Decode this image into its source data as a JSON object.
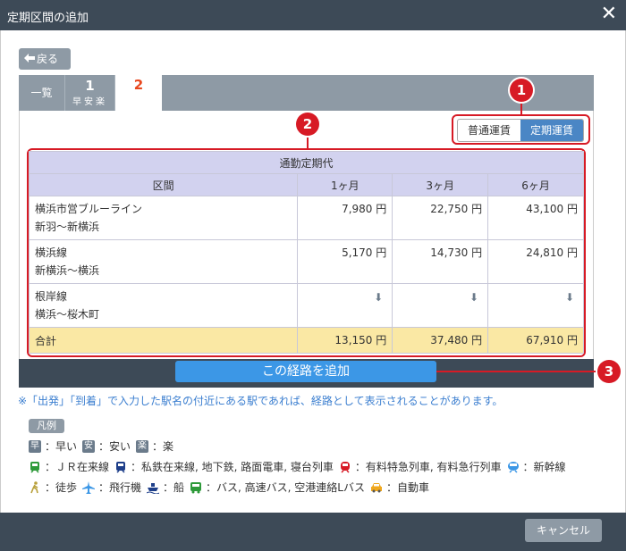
{
  "window": {
    "title": "定期区間の追加",
    "close_glyph": "✕"
  },
  "back_button": {
    "label": "戻る",
    "icon": "back-arrow-icon"
  },
  "tabs": [
    {
      "label": "一覧"
    },
    {
      "number": "1",
      "sub": "早安楽"
    },
    {
      "number": "2"
    }
  ],
  "fare_toggle": {
    "options": [
      "普通運賃",
      "定期運賃"
    ],
    "selected": "定期運賃"
  },
  "callouts": [
    "1",
    "2",
    "3"
  ],
  "fare_table": {
    "caption": "通勤定期代",
    "headers": [
      "区間",
      "1ヶ月",
      "3ヶ月",
      "6ヶ月"
    ],
    "rows": [
      {
        "line": "横浜市営ブルーライン",
        "section": "新羽〜新横浜",
        "m1": "7,980 円",
        "m3": "22,750 円",
        "m6": "43,100 円"
      },
      {
        "line": "横浜線",
        "section": "新横浜〜横浜",
        "m1": "5,170 円",
        "m3": "14,730 円",
        "m6": "24,810 円"
      },
      {
        "line": "根岸線",
        "section": "横浜〜桜木町",
        "arrow": "⬇"
      }
    ],
    "total": {
      "label": "合計",
      "m1": "13,150 円",
      "m3": "37,480 円",
      "m6": "67,910 円"
    }
  },
  "add_button": {
    "label": "この経路を追加"
  },
  "note": "※「出発」「到着」で入力した駅名の付近にある駅であれば、経路として表示されることがあります。",
  "legend": {
    "title": "凡例",
    "row1": [
      {
        "icon": "早",
        "text": "：早い"
      },
      {
        "icon": "安",
        "text": "：安い"
      },
      {
        "icon": "楽",
        "text": "：楽"
      }
    ],
    "row2": [
      {
        "text": "：ＪＲ在来線"
      },
      {
        "text": "：私鉄在来線, 地下鉄, 路面電車, 寝台列車"
      },
      {
        "text": "：有料特急列車, 有料急行列車"
      },
      {
        "text": "：新幹線"
      }
    ],
    "row3": [
      {
        "text": "：徒歩"
      },
      {
        "text": "：飛行機"
      },
      {
        "text": "：船"
      },
      {
        "text": "：バス, 高速バス, 空港連絡Lバス"
      },
      {
        "text": "：自動車"
      }
    ]
  },
  "colors": {
    "accent": "#4a86c5",
    "callout": "#d71a25",
    "header_bg": "#3d4a57",
    "total_bg": "#fae8a4"
  },
  "cancel_button": {
    "label": "キャンセル"
  }
}
